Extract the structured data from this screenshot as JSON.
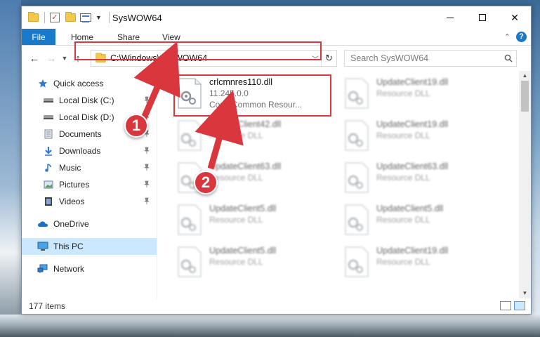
{
  "window": {
    "title": "SysWOW64"
  },
  "ribbon": {
    "file_label": "File",
    "tabs": [
      "Home",
      "Share",
      "View"
    ]
  },
  "address": {
    "path": "C:\\Windows\\SysWOW64"
  },
  "search": {
    "placeholder": "Search SysWOW64"
  },
  "sidebar": {
    "items": [
      {
        "label": "Quick access",
        "icon": "star-icon"
      },
      {
        "label": "Local Disk (C:)",
        "icon": "drive-icon"
      },
      {
        "label": "Local Disk (D:)",
        "icon": "drive-icon"
      },
      {
        "label": "Documents",
        "icon": "documents-icon"
      },
      {
        "label": "Downloads",
        "icon": "download-icon"
      },
      {
        "label": "Music",
        "icon": "music-icon"
      },
      {
        "label": "Pictures",
        "icon": "pictures-icon"
      },
      {
        "label": "Videos",
        "icon": "videos-icon"
      },
      {
        "label": "OneDrive",
        "icon": "cloud-icon"
      },
      {
        "label": "This PC",
        "icon": "computer-icon"
      },
      {
        "label": "Network",
        "icon": "network-icon"
      }
    ]
  },
  "files": [
    {
      "name": "crlcmnres110.dll",
      "line2": "11.245.0.0",
      "line3": "Corel Common Resour..."
    },
    {
      "name": "UpdateClient19.dll",
      "line2": "Resource DLL"
    },
    {
      "name": "UpdateClient42.dll",
      "line2": "Resource DLL"
    },
    {
      "name": "UpdateClient19.dll",
      "line2": "Resource DLL"
    },
    {
      "name": "UpdateClient63.dll",
      "line2": "Resource DLL"
    },
    {
      "name": "UpdateClient63.dll",
      "line2": "Resource DLL"
    },
    {
      "name": "UpdateClient5.dll",
      "line2": "Resource DLL"
    },
    {
      "name": "UpdateClient5.dll",
      "line2": "Resource DLL"
    },
    {
      "name": "UpdateClient5.dll",
      "line2": "Resource DLL"
    },
    {
      "name": "UpdateClient19.dll",
      "line2": "Resource DLL"
    }
  ],
  "status": {
    "count": "177 items"
  },
  "annotations": {
    "badge1": "1",
    "badge2": "2",
    "color": "#d9363e"
  },
  "colors": {
    "accent": "#1979ca",
    "selection": "#cce8ff"
  }
}
